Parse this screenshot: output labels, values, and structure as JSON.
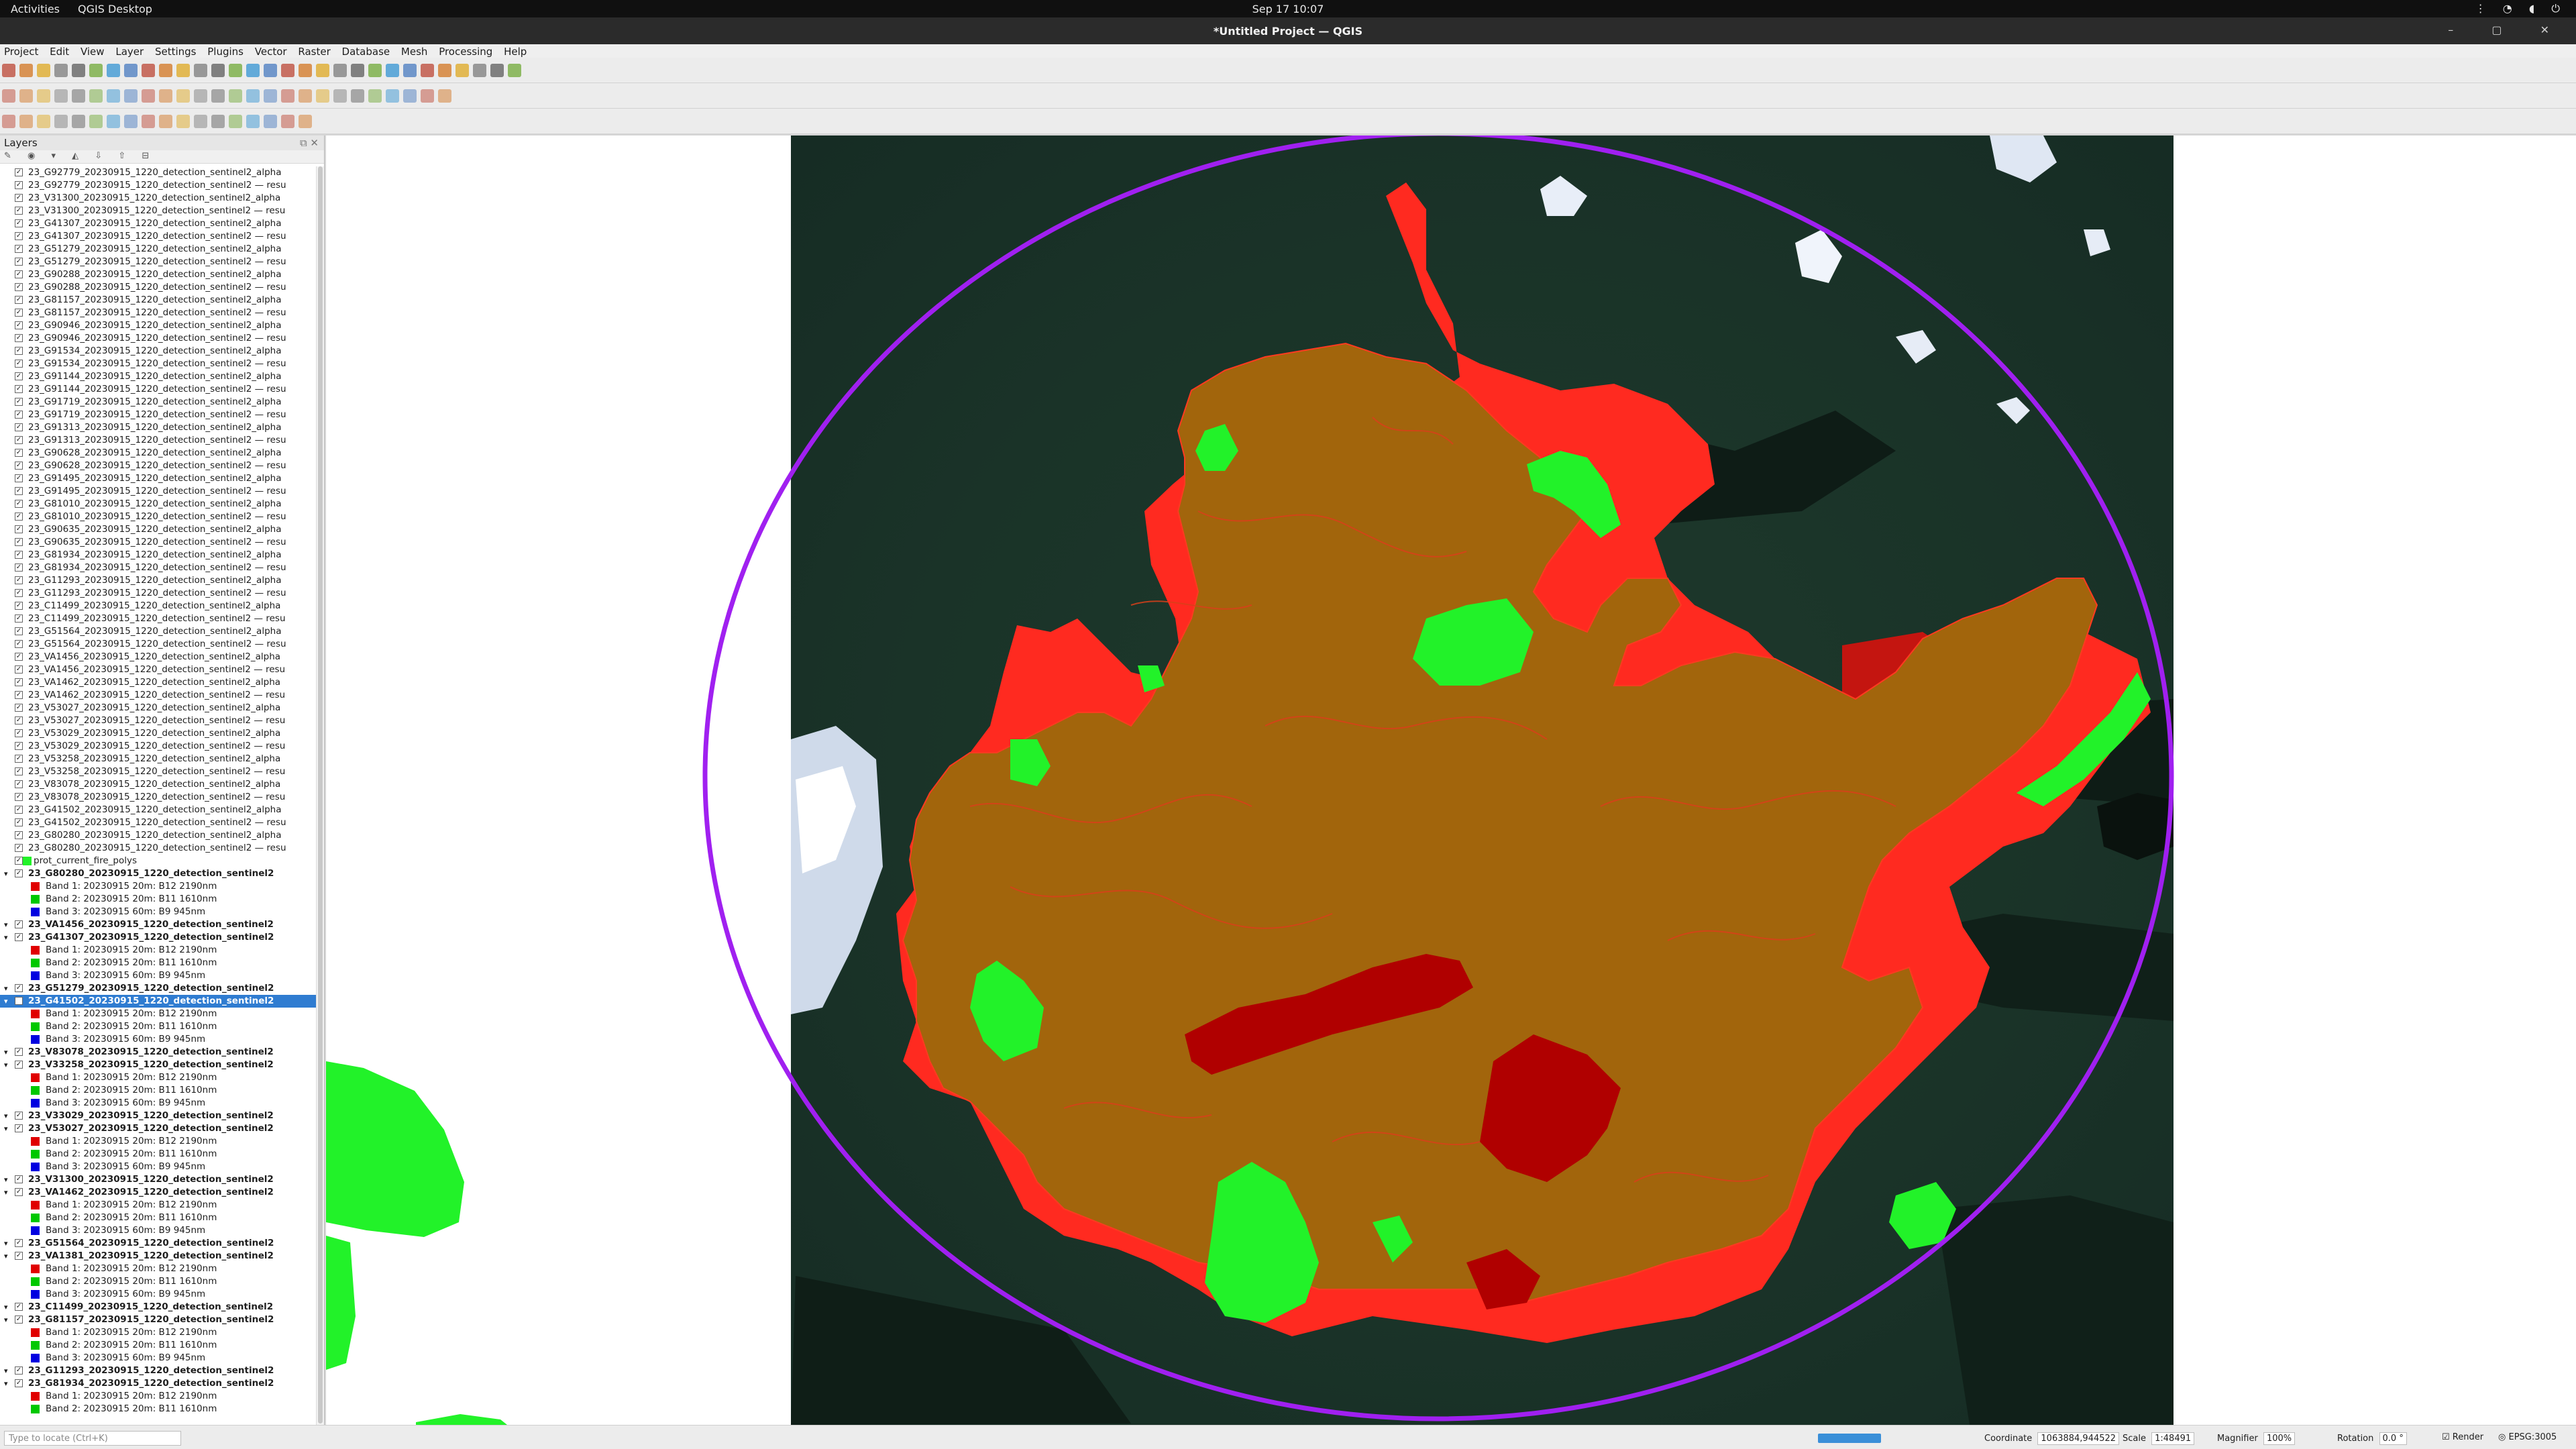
{
  "system": {
    "activities": "Activities",
    "app_name": "QGIS Desktop",
    "clock": "Sep 17  10:07"
  },
  "window": {
    "title": "*Untitled Project — QGIS"
  },
  "menu": [
    "Project",
    "Edit",
    "View",
    "Layer",
    "Settings",
    "Plugins",
    "Vector",
    "Raster",
    "Database",
    "Mesh",
    "Processing",
    "Help"
  ],
  "layers_panel": {
    "title": "Layers"
  },
  "layers": [
    {
      "name": "23_G92779_20230915_1220_detection_sentinel2_alpha",
      "kind": "v"
    },
    {
      "name": "23_G92779_20230915_1220_detection_sentinel2 — resu",
      "kind": "v"
    },
    {
      "name": "23_V31300_20230915_1220_detection_sentinel2_alpha",
      "kind": "v"
    },
    {
      "name": "23_V31300_20230915_1220_detection_sentinel2 — resu",
      "kind": "v"
    },
    {
      "name": "23_G41307_20230915_1220_detection_sentinel2_alpha",
      "kind": "v"
    },
    {
      "name": "23_G41307_20230915_1220_detection_sentinel2 — resu",
      "kind": "v"
    },
    {
      "name": "23_G51279_20230915_1220_detection_sentinel2_alpha",
      "kind": "v"
    },
    {
      "name": "23_G51279_20230915_1220_detection_sentinel2 — resu",
      "kind": "v"
    },
    {
      "name": "23_G90288_20230915_1220_detection_sentinel2_alpha",
      "kind": "v"
    },
    {
      "name": "23_G90288_20230915_1220_detection_sentinel2 — resu",
      "kind": "v"
    },
    {
      "name": "23_G81157_20230915_1220_detection_sentinel2_alpha",
      "kind": "v"
    },
    {
      "name": "23_G81157_20230915_1220_detection_sentinel2 — resu",
      "kind": "v"
    },
    {
      "name": "23_G90946_20230915_1220_detection_sentinel2_alpha",
      "kind": "v"
    },
    {
      "name": "23_G90946_20230915_1220_detection_sentinel2 — resu",
      "kind": "v"
    },
    {
      "name": "23_G91534_20230915_1220_detection_sentinel2_alpha",
      "kind": "v"
    },
    {
      "name": "23_G91534_20230915_1220_detection_sentinel2 — resu",
      "kind": "v"
    },
    {
      "name": "23_G91144_20230915_1220_detection_sentinel2_alpha",
      "kind": "v"
    },
    {
      "name": "23_G91144_20230915_1220_detection_sentinel2 — resu",
      "kind": "v"
    },
    {
      "name": "23_G91719_20230915_1220_detection_sentinel2_alpha",
      "kind": "v"
    },
    {
      "name": "23_G91719_20230915_1220_detection_sentinel2 — resu",
      "kind": "v"
    },
    {
      "name": "23_G91313_20230915_1220_detection_sentinel2_alpha",
      "kind": "v"
    },
    {
      "name": "23_G91313_20230915_1220_detection_sentinel2 — resu",
      "kind": "v"
    },
    {
      "name": "23_G90628_20230915_1220_detection_sentinel2_alpha",
      "kind": "v"
    },
    {
      "name": "23_G90628_20230915_1220_detection_sentinel2 — resu",
      "kind": "v"
    },
    {
      "name": "23_G91495_20230915_1220_detection_sentinel2_alpha",
      "kind": "v"
    },
    {
      "name": "23_G91495_20230915_1220_detection_sentinel2 — resu",
      "kind": "v"
    },
    {
      "name": "23_G81010_20230915_1220_detection_sentinel2_alpha",
      "kind": "v"
    },
    {
      "name": "23_G81010_20230915_1220_detection_sentinel2 — resu",
      "kind": "v"
    },
    {
      "name": "23_G90635_20230915_1220_detection_sentinel2_alpha",
      "kind": "v"
    },
    {
      "name": "23_G90635_20230915_1220_detection_sentinel2 — resu",
      "kind": "v"
    },
    {
      "name": "23_G81934_20230915_1220_detection_sentinel2_alpha",
      "kind": "v"
    },
    {
      "name": "23_G81934_20230915_1220_detection_sentinel2 — resu",
      "kind": "v"
    },
    {
      "name": "23_G11293_20230915_1220_detection_sentinel2_alpha",
      "kind": "v"
    },
    {
      "name": "23_G11293_20230915_1220_detection_sentinel2 — resu",
      "kind": "v"
    },
    {
      "name": "23_C11499_20230915_1220_detection_sentinel2_alpha",
      "kind": "v"
    },
    {
      "name": "23_C11499_20230915_1220_detection_sentinel2 — resu",
      "kind": "v"
    },
    {
      "name": "23_G51564_20230915_1220_detection_sentinel2_alpha",
      "kind": "v"
    },
    {
      "name": "23_G51564_20230915_1220_detection_sentinel2 — resu",
      "kind": "v"
    },
    {
      "name": "23_VA1456_20230915_1220_detection_sentinel2_alpha",
      "kind": "v"
    },
    {
      "name": "23_VA1456_20230915_1220_detection_sentinel2 — resu",
      "kind": "v"
    },
    {
      "name": "23_VA1462_20230915_1220_detection_sentinel2_alpha",
      "kind": "v"
    },
    {
      "name": "23_VA1462_20230915_1220_detection_sentinel2 — resu",
      "kind": "v"
    },
    {
      "name": "23_V53027_20230915_1220_detection_sentinel2_alpha",
      "kind": "v"
    },
    {
      "name": "23_V53027_20230915_1220_detection_sentinel2 — resu",
      "kind": "v"
    },
    {
      "name": "23_V53029_20230915_1220_detection_sentinel2_alpha",
      "kind": "v"
    },
    {
      "name": "23_V53029_20230915_1220_detection_sentinel2 — resu",
      "kind": "v"
    },
    {
      "name": "23_V53258_20230915_1220_detection_sentinel2_alpha",
      "kind": "v"
    },
    {
      "name": "23_V53258_20230915_1220_detection_sentinel2 — resu",
      "kind": "v"
    },
    {
      "name": "23_V83078_20230915_1220_detection_sentinel2_alpha",
      "kind": "v"
    },
    {
      "name": "23_V83078_20230915_1220_detection_sentinel2 — resu",
      "kind": "v"
    },
    {
      "name": "23_G41502_20230915_1220_detection_sentinel2_alpha",
      "kind": "v"
    },
    {
      "name": "23_G41502_20230915_1220_detection_sentinel2 — resu",
      "kind": "v"
    },
    {
      "name": "23_G80280_20230915_1220_detection_sentinel2_alpha",
      "kind": "v"
    },
    {
      "name": "23_G80280_20230915_1220_detection_sentinel2 — resu",
      "kind": "v"
    },
    {
      "name": "prot_current_fire_polys",
      "kind": "p"
    },
    {
      "name": "23_G80280_20230915_1220_detection_sentinel2",
      "kind": "g"
    },
    {
      "name": "Band 1: 20230915 20m: B12 2190nm",
      "kind": "b",
      "color": "#e00000"
    },
    {
      "name": "Band 2: 20230915 20m: B11 1610nm",
      "kind": "b",
      "color": "#00c800"
    },
    {
      "name": "Band 3: 20230915 60m: B9 945nm",
      "kind": "b",
      "color": "#0000e0"
    },
    {
      "name": "23_VA1456_20230915_1220_detection_sentinel2",
      "kind": "g"
    },
    {
      "name": "23_G41307_20230915_1220_detection_sentinel2",
      "kind": "g"
    },
    {
      "name": "Band 1: 20230915 20m: B12 2190nm",
      "kind": "b",
      "color": "#e00000"
    },
    {
      "name": "Band 2: 20230915 20m: B11 1610nm",
      "kind": "b",
      "color": "#00c800"
    },
    {
      "name": "Band 3: 20230915 60m: B9 945nm",
      "kind": "b",
      "color": "#0000e0"
    },
    {
      "name": "23_G51279_20230915_1220_detection_sentinel2",
      "kind": "g"
    },
    {
      "name": "23_G41502_20230915_1220_detection_sentinel2",
      "kind": "g",
      "selected": true
    },
    {
      "name": "Band 1: 20230915 20m: B12 2190nm",
      "kind": "b",
      "color": "#e00000"
    },
    {
      "name": "Band 2: 20230915 20m: B11 1610nm",
      "kind": "b",
      "color": "#00c800"
    },
    {
      "name": "Band 3: 20230915 60m: B9 945nm",
      "kind": "b",
      "color": "#0000e0"
    },
    {
      "name": "23_V83078_20230915_1220_detection_sentinel2",
      "kind": "g"
    },
    {
      "name": "23_V33258_20230915_1220_detection_sentinel2",
      "kind": "g"
    },
    {
      "name": "Band 1: 20230915 20m: B12 2190nm",
      "kind": "b",
      "color": "#e00000"
    },
    {
      "name": "Band 2: 20230915 20m: B11 1610nm",
      "kind": "b",
      "color": "#00c800"
    },
    {
      "name": "Band 3: 20230915 60m: B9 945nm",
      "kind": "b",
      "color": "#0000e0"
    },
    {
      "name": "23_V33029_20230915_1220_detection_sentinel2",
      "kind": "g"
    },
    {
      "name": "23_V53027_20230915_1220_detection_sentinel2",
      "kind": "g"
    },
    {
      "name": "Band 1: 20230915 20m: B12 2190nm",
      "kind": "b",
      "color": "#e00000"
    },
    {
      "name": "Band 2: 20230915 20m: B11 1610nm",
      "kind": "b",
      "color": "#00c800"
    },
    {
      "name": "Band 3: 20230915 60m: B9 945nm",
      "kind": "b",
      "color": "#0000e0"
    },
    {
      "name": "23_V31300_20230915_1220_detection_sentinel2",
      "kind": "g"
    },
    {
      "name": "23_VA1462_20230915_1220_detection_sentinel2",
      "kind": "g"
    },
    {
      "name": "Band 1: 20230915 20m: B12 2190nm",
      "kind": "b",
      "color": "#e00000"
    },
    {
      "name": "Band 2: 20230915 20m: B11 1610nm",
      "kind": "b",
      "color": "#00c800"
    },
    {
      "name": "Band 3: 20230915 60m: B9 945nm",
      "kind": "b",
      "color": "#0000e0"
    },
    {
      "name": "23_G51564_20230915_1220_detection_sentinel2",
      "kind": "g"
    },
    {
      "name": "23_VA1381_20230915_1220_detection_sentinel2",
      "kind": "g"
    },
    {
      "name": "Band 1: 20230915 20m: B12 2190nm",
      "kind": "b",
      "color": "#e00000"
    },
    {
      "name": "Band 2: 20230915 20m: B11 1610nm",
      "kind": "b",
      "color": "#00c800"
    },
    {
      "name": "Band 3: 20230915 60m: B9 945nm",
      "kind": "b",
      "color": "#0000e0"
    },
    {
      "name": "23_C11499_20230915_1220_detection_sentinel2",
      "kind": "g"
    },
    {
      "name": "23_G81157_20230915_1220_detection_sentinel2",
      "kind": "g"
    },
    {
      "name": "Band 1: 20230915 20m: B12 2190nm",
      "kind": "b",
      "color": "#e00000"
    },
    {
      "name": "Band 2: 20230915 20m: B11 1610nm",
      "kind": "b",
      "color": "#00c800"
    },
    {
      "name": "Band 3: 20230915 60m: B9 945nm",
      "kind": "b",
      "color": "#0000e0"
    },
    {
      "name": "23_G11293_20230915_1220_detection_sentinel2",
      "kind": "g"
    },
    {
      "name": "23_G81934_20230915_1220_detection_sentinel2",
      "kind": "g"
    },
    {
      "name": "Band 1: 20230915 20m: B12 2190nm",
      "kind": "b",
      "color": "#e00000"
    },
    {
      "name": "Band 2: 20230915 20m: B11 1610nm",
      "kind": "b",
      "color": "#00c800"
    }
  ],
  "status": {
    "locator_placeholder": "Type to locate (Ctrl+K)",
    "coordinate_label": "Coordinate",
    "coordinate_value": "1063884,944522",
    "scale_label": "Scale",
    "scale_value": "1:48491",
    "magnifier_label": "Magnifier",
    "magnifier_value": "100%",
    "rotation_label": "Rotation",
    "rotation_value": "0.0 °",
    "render_label": "Render",
    "crs": "EPSG:3005"
  },
  "colors": {
    "burn_polygon": "#a2650c",
    "hotspot_red": "#ff2a20",
    "green_patch": "#22f229",
    "buffer_circle": "#a020f0",
    "selection": "#2f7cd1"
  }
}
